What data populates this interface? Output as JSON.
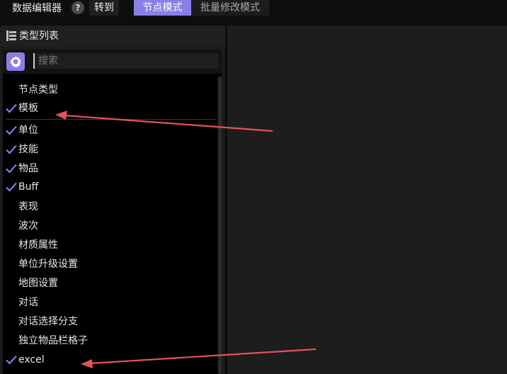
{
  "toolbar": {
    "title": "数据编辑器",
    "help_label": "?",
    "goto_label": "转到",
    "tabs": [
      {
        "label": "节点模式",
        "active": true
      },
      {
        "label": "批量修改模式",
        "active": false
      }
    ]
  },
  "type_list": {
    "title": "类型列表",
    "search_placeholder": "搜索",
    "items": [
      {
        "label": "节点类型",
        "checked": false
      },
      {
        "label": "模板",
        "checked": true
      },
      {
        "label": "单位",
        "checked": true
      },
      {
        "label": "技能",
        "checked": true
      },
      {
        "label": "物品",
        "checked": true
      },
      {
        "label": "Buff",
        "checked": true
      },
      {
        "label": "表现",
        "checked": false
      },
      {
        "label": "波次",
        "checked": false
      },
      {
        "label": "材质属性",
        "checked": false
      },
      {
        "label": "单位升级设置",
        "checked": false
      },
      {
        "label": "地图设置",
        "checked": false
      },
      {
        "label": "对话",
        "checked": false
      },
      {
        "label": "对话选择分支",
        "checked": false
      },
      {
        "label": "独立物品栏格子",
        "checked": false
      },
      {
        "label": "excel",
        "checked": true
      }
    ]
  },
  "colors": {
    "accent": "#8a7fe8",
    "check": "#8f84ff",
    "annotation_arrow": "#e8505b"
  }
}
